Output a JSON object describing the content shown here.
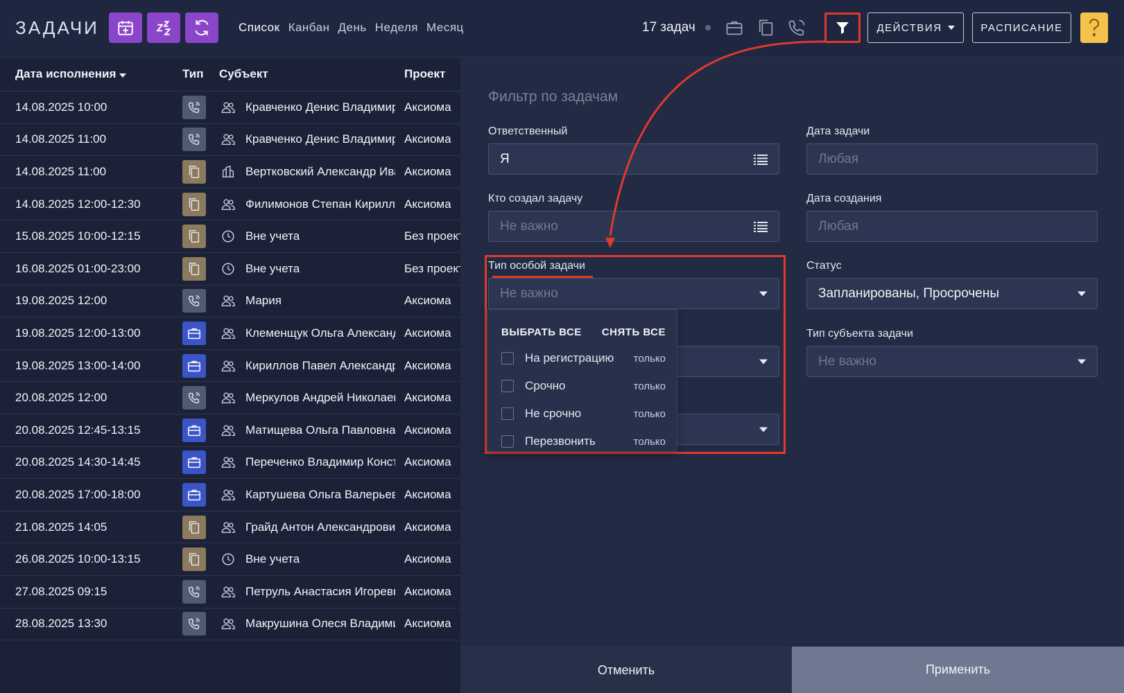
{
  "header": {
    "title": "ЗАДАЧИ",
    "views": [
      "Список",
      "Канбан",
      "День",
      "Неделя",
      "Месяц"
    ],
    "task_count": "17 задач",
    "actions_label": "ДЕЙСТВИЯ",
    "schedule_label": "РАСПИСАНИЕ",
    "accent": "#8a45c9"
  },
  "table": {
    "headers": {
      "date": "Дата исполнения",
      "type": "Тип",
      "subject": "Субъект",
      "project": "Проект"
    },
    "rows": [
      {
        "date": "14.08.2025 10:00",
        "type": "call",
        "subject_icon": "people",
        "subject": "Кравченко Денис Владимирович",
        "project": "Аксиома"
      },
      {
        "date": "14.08.2025 11:00",
        "type": "call",
        "subject_icon": "people",
        "subject": "Кравченко Денис Владимирович",
        "project": "Аксиома"
      },
      {
        "date": "14.08.2025 11:00",
        "type": "doc",
        "subject_icon": "building",
        "subject": "Вертковский Александр Иванович",
        "project": "Аксиома"
      },
      {
        "date": "14.08.2025 12:00-12:30",
        "type": "doc",
        "subject_icon": "people",
        "subject": "Филимонов Степан Кириллович",
        "project": "Аксиома"
      },
      {
        "date": "15.08.2025 10:00-12:15",
        "type": "doc",
        "subject_icon": "clock",
        "subject": "Вне учета",
        "project": "Без проекта"
      },
      {
        "date": "16.08.2025 01:00-23:00",
        "type": "doc",
        "subject_icon": "clock",
        "subject": "Вне учета",
        "project": "Без проекта"
      },
      {
        "date": "19.08.2025 12:00",
        "type": "call",
        "subject_icon": "people",
        "subject": "Мария",
        "project": "Аксиома"
      },
      {
        "date": "19.08.2025 12:00-13:00",
        "type": "case",
        "subject_icon": "people",
        "subject": "Клеменщук Ольга Александровна",
        "project": "Аксиома"
      },
      {
        "date": "19.08.2025 13:00-14:00",
        "type": "case",
        "subject_icon": "people",
        "subject": "Кириллов Павел Александрович",
        "project": "Аксиома"
      },
      {
        "date": "20.08.2025 12:00",
        "type": "call",
        "subject_icon": "people",
        "subject": "Меркулов Андрей Николаевич",
        "project": "Аксиома"
      },
      {
        "date": "20.08.2025 12:45-13:15",
        "type": "case",
        "subject_icon": "people",
        "subject": "Матищева Ольга Павловна",
        "project": "Аксиома"
      },
      {
        "date": "20.08.2025 14:30-14:45",
        "type": "case",
        "subject_icon": "people",
        "subject": "Переченко Владимир Константинович",
        "project": "Аксиома"
      },
      {
        "date": "20.08.2025 17:00-18:00",
        "type": "case",
        "subject_icon": "people",
        "subject": "Картушева Ольга Валерьевна",
        "project": "Аксиома"
      },
      {
        "date": "21.08.2025 14:05",
        "type": "doc",
        "subject_icon": "people",
        "subject": "Грайд Антон Александрович",
        "project": "Аксиома"
      },
      {
        "date": "26.08.2025 10:00-13:15",
        "type": "doc",
        "subject_icon": "clock",
        "subject": "Вне учета",
        "project": "Аксиома"
      },
      {
        "date": "27.08.2025 09:15",
        "type": "call",
        "subject_icon": "people",
        "subject": "Петруль Анастасия Игоревна",
        "project": "Аксиома"
      },
      {
        "date": "28.08.2025 13:30",
        "type": "call",
        "subject_icon": "people",
        "subject": "Макрушина Олеся Владимировна",
        "project": "Аксиома"
      }
    ]
  },
  "filter": {
    "title": "Фильтр по задачам",
    "responsible_label": "Ответственный",
    "responsible_value": "Я",
    "creator_label": "Кто создал задачу",
    "creator_placeholder": "Не важно",
    "special_type_label": "Тип особой задачи",
    "special_type_placeholder": "Не важно",
    "task_date_label": "Дата задачи",
    "task_date_placeholder": "Любая",
    "created_date_label": "Дата создания",
    "created_date_placeholder": "Любая",
    "status_label": "Статус",
    "status_value": "Запланированы, Просрочены",
    "subject_type_label": "Тип субъекта задачи",
    "subject_type_placeholder": "Не важно",
    "dropdown": {
      "select_all": "ВЫБРАТЬ ВСЕ",
      "clear_all": "СНЯТЬ ВСЕ",
      "only_label": "только",
      "options": [
        "На регистрацию",
        "Срочно",
        "Не срочно",
        "Перезвонить"
      ]
    },
    "cancel_label": "Отменить",
    "apply_label": "Применить",
    "annotation_color": "#e03a2b"
  }
}
